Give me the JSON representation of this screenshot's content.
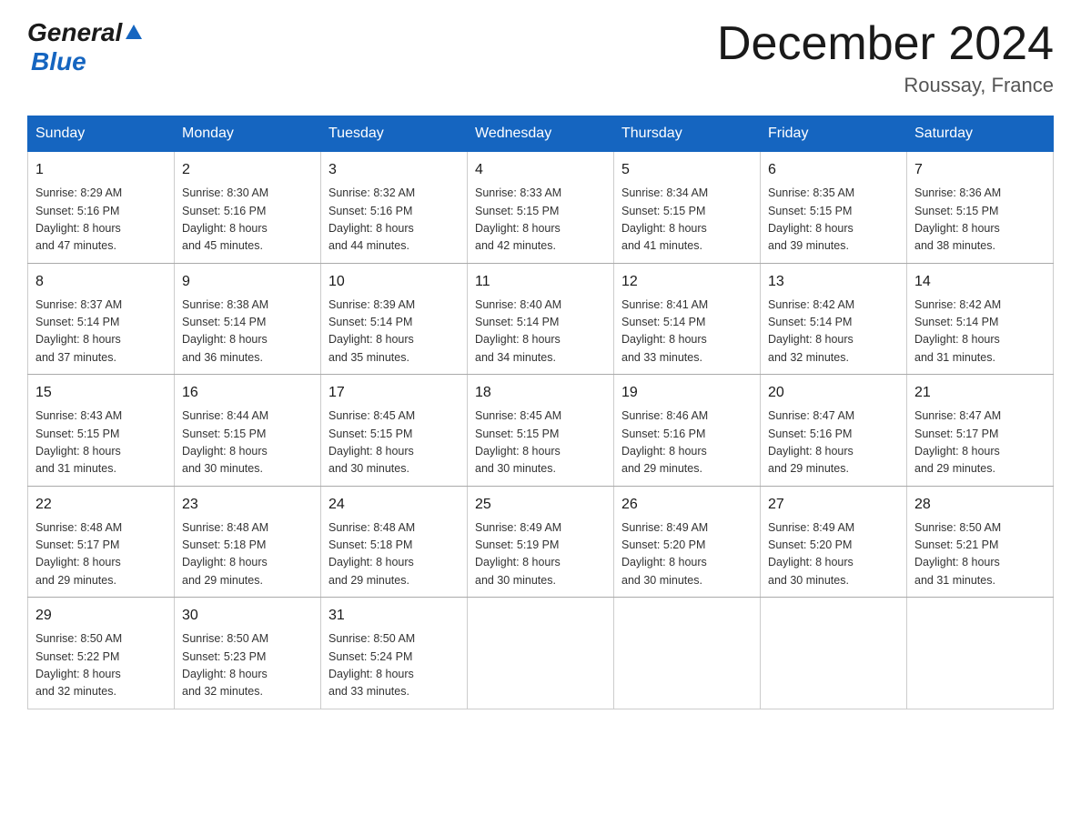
{
  "header": {
    "logo_general": "General",
    "logo_blue": "Blue",
    "month_title": "December 2024",
    "location": "Roussay, France"
  },
  "days_of_week": [
    "Sunday",
    "Monday",
    "Tuesday",
    "Wednesday",
    "Thursday",
    "Friday",
    "Saturday"
  ],
  "weeks": [
    [
      {
        "day": "1",
        "sunrise": "8:29 AM",
        "sunset": "5:16 PM",
        "daylight": "8 hours and 47 minutes."
      },
      {
        "day": "2",
        "sunrise": "8:30 AM",
        "sunset": "5:16 PM",
        "daylight": "8 hours and 45 minutes."
      },
      {
        "day": "3",
        "sunrise": "8:32 AM",
        "sunset": "5:16 PM",
        "daylight": "8 hours and 44 minutes."
      },
      {
        "day": "4",
        "sunrise": "8:33 AM",
        "sunset": "5:15 PM",
        "daylight": "8 hours and 42 minutes."
      },
      {
        "day": "5",
        "sunrise": "8:34 AM",
        "sunset": "5:15 PM",
        "daylight": "8 hours and 41 minutes."
      },
      {
        "day": "6",
        "sunrise": "8:35 AM",
        "sunset": "5:15 PM",
        "daylight": "8 hours and 39 minutes."
      },
      {
        "day": "7",
        "sunrise": "8:36 AM",
        "sunset": "5:15 PM",
        "daylight": "8 hours and 38 minutes."
      }
    ],
    [
      {
        "day": "8",
        "sunrise": "8:37 AM",
        "sunset": "5:14 PM",
        "daylight": "8 hours and 37 minutes."
      },
      {
        "day": "9",
        "sunrise": "8:38 AM",
        "sunset": "5:14 PM",
        "daylight": "8 hours and 36 minutes."
      },
      {
        "day": "10",
        "sunrise": "8:39 AM",
        "sunset": "5:14 PM",
        "daylight": "8 hours and 35 minutes."
      },
      {
        "day": "11",
        "sunrise": "8:40 AM",
        "sunset": "5:14 PM",
        "daylight": "8 hours and 34 minutes."
      },
      {
        "day": "12",
        "sunrise": "8:41 AM",
        "sunset": "5:14 PM",
        "daylight": "8 hours and 33 minutes."
      },
      {
        "day": "13",
        "sunrise": "8:42 AM",
        "sunset": "5:14 PM",
        "daylight": "8 hours and 32 minutes."
      },
      {
        "day": "14",
        "sunrise": "8:42 AM",
        "sunset": "5:14 PM",
        "daylight": "8 hours and 31 minutes."
      }
    ],
    [
      {
        "day": "15",
        "sunrise": "8:43 AM",
        "sunset": "5:15 PM",
        "daylight": "8 hours and 31 minutes."
      },
      {
        "day": "16",
        "sunrise": "8:44 AM",
        "sunset": "5:15 PM",
        "daylight": "8 hours and 30 minutes."
      },
      {
        "day": "17",
        "sunrise": "8:45 AM",
        "sunset": "5:15 PM",
        "daylight": "8 hours and 30 minutes."
      },
      {
        "day": "18",
        "sunrise": "8:45 AM",
        "sunset": "5:15 PM",
        "daylight": "8 hours and 30 minutes."
      },
      {
        "day": "19",
        "sunrise": "8:46 AM",
        "sunset": "5:16 PM",
        "daylight": "8 hours and 29 minutes."
      },
      {
        "day": "20",
        "sunrise": "8:47 AM",
        "sunset": "5:16 PM",
        "daylight": "8 hours and 29 minutes."
      },
      {
        "day": "21",
        "sunrise": "8:47 AM",
        "sunset": "5:17 PM",
        "daylight": "8 hours and 29 minutes."
      }
    ],
    [
      {
        "day": "22",
        "sunrise": "8:48 AM",
        "sunset": "5:17 PM",
        "daylight": "8 hours and 29 minutes."
      },
      {
        "day": "23",
        "sunrise": "8:48 AM",
        "sunset": "5:18 PM",
        "daylight": "8 hours and 29 minutes."
      },
      {
        "day": "24",
        "sunrise": "8:48 AM",
        "sunset": "5:18 PM",
        "daylight": "8 hours and 29 minutes."
      },
      {
        "day": "25",
        "sunrise": "8:49 AM",
        "sunset": "5:19 PM",
        "daylight": "8 hours and 30 minutes."
      },
      {
        "day": "26",
        "sunrise": "8:49 AM",
        "sunset": "5:20 PM",
        "daylight": "8 hours and 30 minutes."
      },
      {
        "day": "27",
        "sunrise": "8:49 AM",
        "sunset": "5:20 PM",
        "daylight": "8 hours and 30 minutes."
      },
      {
        "day": "28",
        "sunrise": "8:50 AM",
        "sunset": "5:21 PM",
        "daylight": "8 hours and 31 minutes."
      }
    ],
    [
      {
        "day": "29",
        "sunrise": "8:50 AM",
        "sunset": "5:22 PM",
        "daylight": "8 hours and 32 minutes."
      },
      {
        "day": "30",
        "sunrise": "8:50 AM",
        "sunset": "5:23 PM",
        "daylight": "8 hours and 32 minutes."
      },
      {
        "day": "31",
        "sunrise": "8:50 AM",
        "sunset": "5:24 PM",
        "daylight": "8 hours and 33 minutes."
      },
      null,
      null,
      null,
      null
    ]
  ],
  "labels": {
    "sunrise": "Sunrise:",
    "sunset": "Sunset:",
    "daylight": "Daylight:"
  }
}
